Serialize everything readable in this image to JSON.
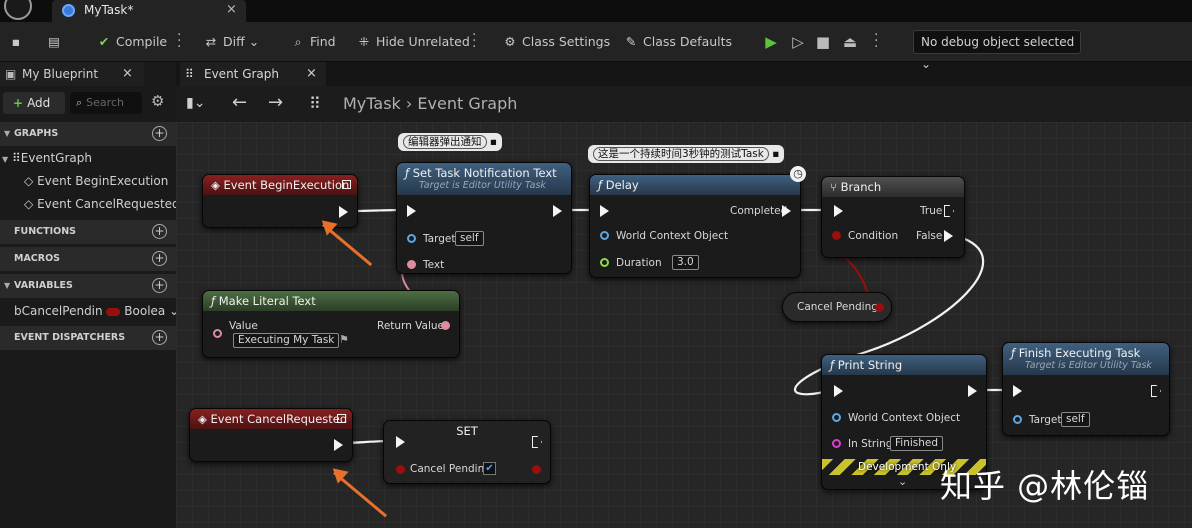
{
  "window": {
    "tab_title": "MyTask*",
    "tab_close": "×"
  },
  "toolbar": {
    "compile": "Compile",
    "diff": "Diff",
    "find": "Find",
    "hide_unrelated": "Hide Unrelated",
    "class_settings": "Class Settings",
    "class_defaults": "Class Defaults",
    "debug_object": "No debug object selected"
  },
  "left_panel": {
    "tab": "My Blueprint",
    "tab_close": "×",
    "add": "Add",
    "search_placeholder": "Search",
    "sections": {
      "graphs": "GRAPHS",
      "functions": "FUNCTIONS",
      "macros": "MACROS",
      "variables": "VARIABLES",
      "dispatchers": "EVENT DISPATCHERS"
    },
    "graphs_items": [
      "EventGraph",
      "Event BeginExecution",
      "Event CancelRequested"
    ],
    "variable": {
      "name": "bCancelPendin",
      "type": "Boolea"
    }
  },
  "graph_tab": {
    "label": "Event Graph",
    "close": "×"
  },
  "breadcrumb": {
    "asset": "MyTask",
    "separator": "›",
    "graph": "Event Graph"
  },
  "nodes": {
    "begin": {
      "title": "Event BeginExecution"
    },
    "set_notify": {
      "title": "Set Task Notification Text",
      "subtitle": "Target is Editor Utility Task",
      "target_label": "Target",
      "target_value": "self",
      "text_label": "Text",
      "comment": "编辑器弹出通知"
    },
    "delay": {
      "title": "Delay",
      "completed": "Completed",
      "world_context": "World Context Object",
      "duration_label": "Duration",
      "duration_value": "3.0",
      "comment": "这是一个持续时间3秒钟的测试Task"
    },
    "branch": {
      "title": "Branch",
      "true_label": "True",
      "condition": "Condition",
      "false_label": "False"
    },
    "literal": {
      "title": "Make Literal Text",
      "value_label": "Value",
      "value": "Executing My Task",
      "return": "Return Value"
    },
    "cancel_get": {
      "label": "Cancel Pending"
    },
    "print": {
      "title": "Print String",
      "world_context": "World Context Object",
      "in_string": "In String",
      "in_string_value": "Finished",
      "dev_only": "Development Only"
    },
    "finish": {
      "title": "Finish Executing Task",
      "subtitle": "Target is Editor Utility Task",
      "target_label": "Target",
      "target_value": "self"
    },
    "cancel_event": {
      "title": "Event CancelRequested"
    },
    "set": {
      "title": "SET",
      "var_label": "Cancel Pending"
    }
  },
  "watermark": "知乎 @林伦锱",
  "colors": {
    "event_header": "#7a1c1c",
    "function_header": "#3b5876",
    "literal_header": "#3e5a36",
    "exec_wire": "#f2f2f2",
    "bool_pin": "#9a0e0e",
    "text_pin": "#e08ca0",
    "object_pin": "#5aa8e6",
    "float_pin": "#8ed94a",
    "arrow": "#e8702a",
    "string_pin": "#e23dd3"
  }
}
